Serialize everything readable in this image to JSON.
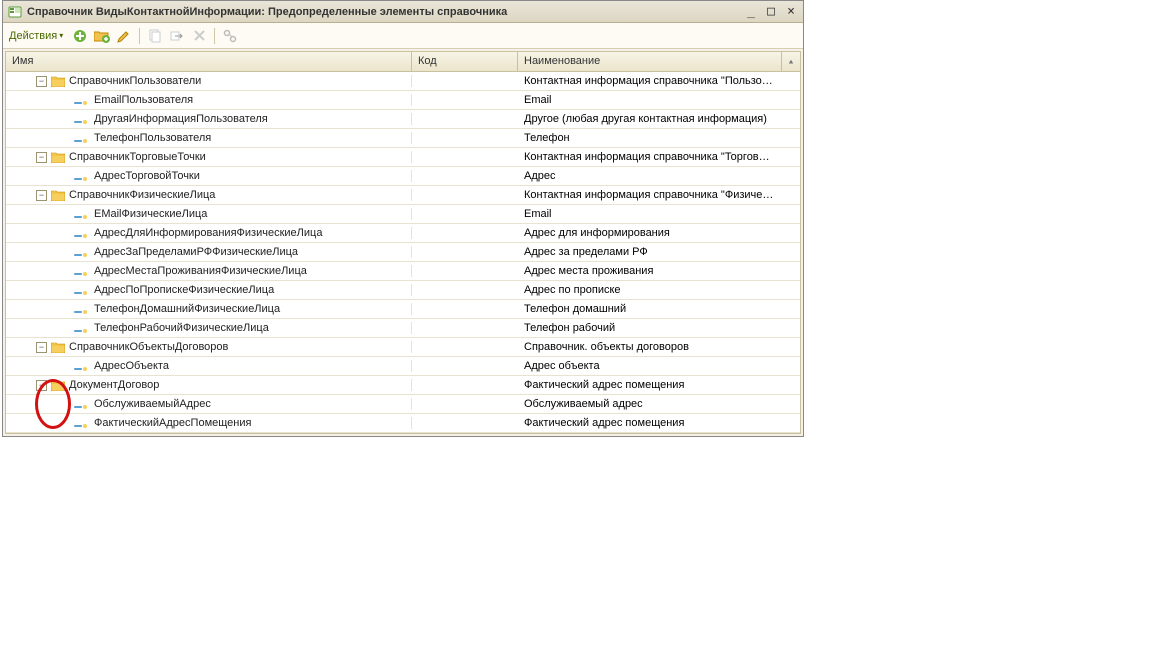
{
  "window": {
    "title": "Справочник ВидыКонтактнойИнформации: Предопределенные элементы справочника"
  },
  "toolbar": {
    "actions_label": "Действия"
  },
  "columns": {
    "name": "Имя",
    "code": "Код",
    "desc": "Наименование"
  },
  "rows": [
    {
      "type": "folder",
      "indent": 0,
      "name": "СправочникПользователи",
      "desc": "Контактная информация справочника \"Пользова..."
    },
    {
      "type": "item",
      "indent": 1,
      "name": "EmailПользователя",
      "desc": "Email"
    },
    {
      "type": "item",
      "indent": 1,
      "name": "ДругаяИнформацияПользователя",
      "desc": "Другое (любая другая контактная информация)"
    },
    {
      "type": "item",
      "indent": 1,
      "name": "ТелефонПользователя",
      "desc": "Телефон"
    },
    {
      "type": "folder",
      "indent": 0,
      "name": "СправочникТорговыеТочки",
      "desc": "Контактная информация справочника \"Торговые..."
    },
    {
      "type": "item",
      "indent": 1,
      "name": "АдресТорговойТочки",
      "desc": "Адрес"
    },
    {
      "type": "folder",
      "indent": 0,
      "name": "СправочникФизическиеЛица",
      "desc": "Контактная информация справочника \"Физичес..."
    },
    {
      "type": "item",
      "indent": 1,
      "name": "EMailФизическиеЛица",
      "desc": "Email"
    },
    {
      "type": "item",
      "indent": 1,
      "name": "АдресДляИнформированияФизическиеЛица",
      "desc": "Адрес для информирования"
    },
    {
      "type": "item",
      "indent": 1,
      "name": "АдресЗаПределамиРФФизическиеЛица",
      "desc": "Адрес за пределами РФ"
    },
    {
      "type": "item",
      "indent": 1,
      "name": "АдресМестаПроживанияФизическиеЛица",
      "desc": "Адрес места проживания"
    },
    {
      "type": "item",
      "indent": 1,
      "name": "АдресПоПропискеФизическиеЛица",
      "desc": "Адрес по прописке"
    },
    {
      "type": "item",
      "indent": 1,
      "name": "ТелефонДомашнийФизическиеЛица",
      "desc": "Телефон домашний"
    },
    {
      "type": "item",
      "indent": 1,
      "name": "ТелефонРабочийФизическиеЛица",
      "desc": "Телефон рабочий"
    },
    {
      "type": "folder",
      "indent": 0,
      "name": "СправочникОбъектыДоговоров",
      "desc": "Справочник. объекты договоров"
    },
    {
      "type": "item",
      "indent": 1,
      "name": "АдресОбъекта",
      "desc": "Адрес объекта"
    },
    {
      "type": "folder",
      "indent": 0,
      "name": "ДокументДоговор",
      "desc": "Фактический адрес помещения"
    },
    {
      "type": "item",
      "indent": 1,
      "name": "ОбслуживаемыйАдрес",
      "desc": "Обслуживаемый адрес"
    },
    {
      "type": "item",
      "indent": 1,
      "name": "ФактическийАдресПомещения",
      "desc": "Фактический адрес помещения"
    }
  ]
}
